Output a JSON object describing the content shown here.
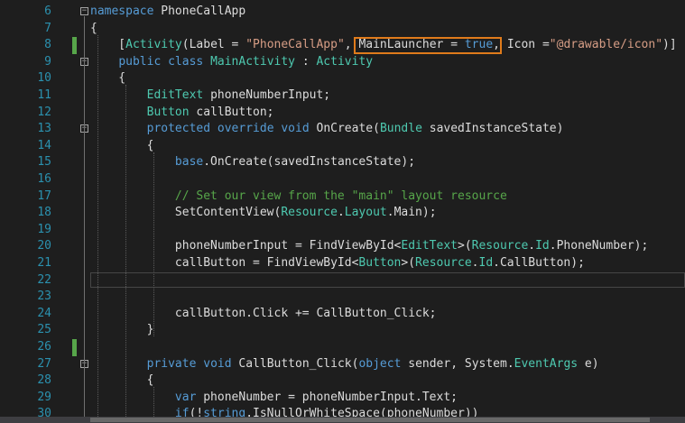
{
  "lines": [
    {
      "n": "6",
      "tokens": [
        {
          "t": "namespace",
          "c": "kw"
        },
        {
          "t": " PhoneCallApp"
        }
      ]
    },
    {
      "n": "7",
      "tokens": [
        {
          "t": "{"
        }
      ]
    },
    {
      "n": "8",
      "tokens": [
        {
          "t": "    ["
        },
        {
          "t": "Activity",
          "c": "ty"
        },
        {
          "t": "(Label = "
        },
        {
          "t": "\"PhoneCallApp\"",
          "c": "st"
        },
        {
          "t": ", MainLauncher = "
        },
        {
          "t": "true",
          "c": "kw"
        },
        {
          "t": ", Icon ="
        },
        {
          "t": "\"@drawable/icon\"",
          "c": "st"
        },
        {
          "t": ")]"
        }
      ]
    },
    {
      "n": "9",
      "tokens": [
        {
          "t": "    "
        },
        {
          "t": "public",
          "c": "kw"
        },
        {
          "t": " "
        },
        {
          "t": "class",
          "c": "kw"
        },
        {
          "t": " "
        },
        {
          "t": "MainActivity",
          "c": "ty"
        },
        {
          "t": " : "
        },
        {
          "t": "Activity",
          "c": "ty"
        }
      ]
    },
    {
      "n": "10",
      "tokens": [
        {
          "t": "    {"
        }
      ]
    },
    {
      "n": "11",
      "tokens": [
        {
          "t": "        "
        },
        {
          "t": "EditText",
          "c": "ty"
        },
        {
          "t": " phoneNumberInput;"
        }
      ]
    },
    {
      "n": "12",
      "tokens": [
        {
          "t": "        "
        },
        {
          "t": "Button",
          "c": "ty"
        },
        {
          "t": " callButton;"
        }
      ]
    },
    {
      "n": "13",
      "tokens": [
        {
          "t": "        "
        },
        {
          "t": "protected",
          "c": "kw"
        },
        {
          "t": " "
        },
        {
          "t": "override",
          "c": "kw"
        },
        {
          "t": " "
        },
        {
          "t": "void",
          "c": "kw"
        },
        {
          "t": " OnCreate("
        },
        {
          "t": "Bundle",
          "c": "ty"
        },
        {
          "t": " savedInstanceState)"
        }
      ]
    },
    {
      "n": "14",
      "tokens": [
        {
          "t": "        {"
        }
      ]
    },
    {
      "n": "15",
      "tokens": [
        {
          "t": "            "
        },
        {
          "t": "base",
          "c": "kw"
        },
        {
          "t": ".OnCreate(savedInstanceState);"
        }
      ]
    },
    {
      "n": "16",
      "tokens": []
    },
    {
      "n": "17",
      "tokens": [
        {
          "t": "            "
        },
        {
          "t": "// Set our view from the \"main\" layout resource",
          "c": "cm"
        }
      ]
    },
    {
      "n": "18",
      "tokens": [
        {
          "t": "            SetContentView("
        },
        {
          "t": "Resource",
          "c": "ty"
        },
        {
          "t": "."
        },
        {
          "t": "Layout",
          "c": "ty"
        },
        {
          "t": ".Main);"
        }
      ]
    },
    {
      "n": "19",
      "tokens": []
    },
    {
      "n": "20",
      "tokens": [
        {
          "t": "            phoneNumberInput = FindViewById<"
        },
        {
          "t": "EditText",
          "c": "ty"
        },
        {
          "t": ">("
        },
        {
          "t": "Resource",
          "c": "ty"
        },
        {
          "t": "."
        },
        {
          "t": "Id",
          "c": "ty"
        },
        {
          "t": ".PhoneNumber);"
        }
      ]
    },
    {
      "n": "21",
      "tokens": [
        {
          "t": "            callButton = FindViewById<"
        },
        {
          "t": "Button",
          "c": "ty"
        },
        {
          "t": ">("
        },
        {
          "t": "Resource",
          "c": "ty"
        },
        {
          "t": "."
        },
        {
          "t": "Id",
          "c": "ty"
        },
        {
          "t": ".CallButton);"
        }
      ]
    },
    {
      "n": "22",
      "tokens": []
    },
    {
      "n": "23",
      "tokens": []
    },
    {
      "n": "24",
      "tokens": [
        {
          "t": "            callButton.Click += CallButton_Click;"
        }
      ]
    },
    {
      "n": "25",
      "tokens": [
        {
          "t": "        }"
        }
      ]
    },
    {
      "n": "26",
      "tokens": []
    },
    {
      "n": "27",
      "tokens": [
        {
          "t": "        "
        },
        {
          "t": "private",
          "c": "kw"
        },
        {
          "t": " "
        },
        {
          "t": "void",
          "c": "kw"
        },
        {
          "t": " CallButton_Click("
        },
        {
          "t": "object",
          "c": "kw"
        },
        {
          "t": " sender, System."
        },
        {
          "t": "EventArgs",
          "c": "ty"
        },
        {
          "t": " e)"
        }
      ]
    },
    {
      "n": "28",
      "tokens": [
        {
          "t": "        {"
        }
      ]
    },
    {
      "n": "29",
      "tokens": [
        {
          "t": "            "
        },
        {
          "t": "var",
          "c": "kw"
        },
        {
          "t": " phoneNumber = phoneNumberInput.Text;"
        }
      ]
    },
    {
      "n": "30",
      "tokens": [
        {
          "t": "            "
        },
        {
          "t": "if",
          "c": "kw"
        },
        {
          "t": "(!"
        },
        {
          "t": "string",
          "c": "kw"
        },
        {
          "t": ".IsNullOrWhiteSpace(phoneNumber))"
        }
      ]
    }
  ],
  "colors": {
    "keyword": "#569cd6",
    "type": "#4ec9b0",
    "string": "#d69d85",
    "comment": "#57a64a",
    "highlight": "#e07b1b"
  }
}
